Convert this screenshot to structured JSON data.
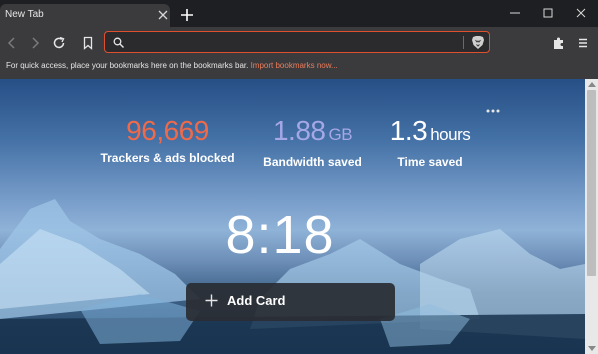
{
  "tab": {
    "title": "New Tab"
  },
  "toolbar": {
    "search": {
      "value": "",
      "placeholder": ""
    }
  },
  "bookmarks_bar": {
    "message": "For quick access, place your bookmarks here on the bookmarks bar.",
    "import_link": "Import bookmarks now..."
  },
  "stats": [
    {
      "value": "96,669",
      "unit": "",
      "label": "Trackers & ads blocked",
      "color": "#f06a4a"
    },
    {
      "value": "1.88",
      "unit": "GB",
      "label": "Bandwidth saved",
      "color": "#a5a7e6"
    },
    {
      "value": "1.3",
      "unit": "hours",
      "label": "Time saved",
      "color": "#ffffff"
    }
  ],
  "clock": "8:18",
  "add_card": {
    "label": "Add Card"
  },
  "colors": {
    "accent": "#e0502e",
    "link": "#ea7d5a",
    "toolbar_bg": "#3b3b3e"
  }
}
